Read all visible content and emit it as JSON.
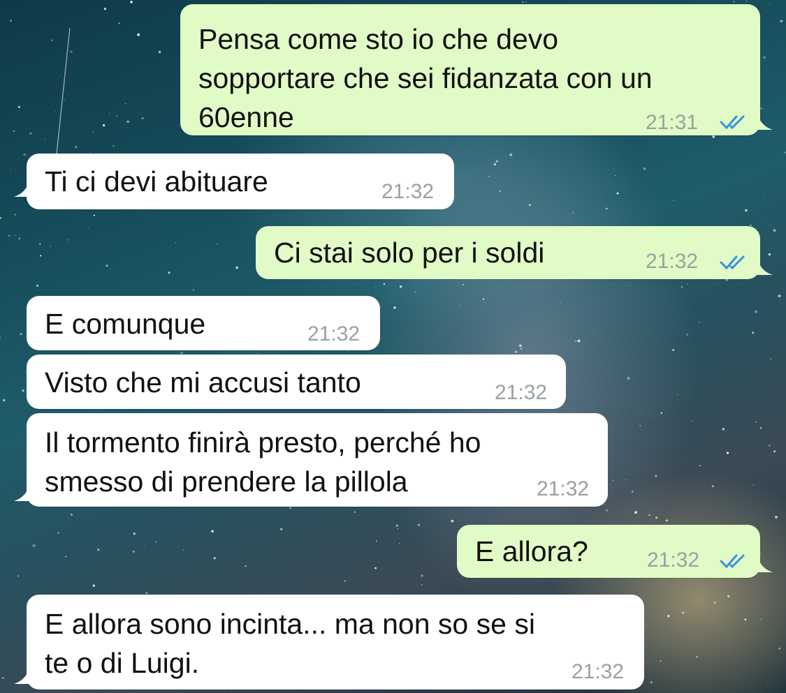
{
  "conversation": {
    "messages": [
      {
        "direction": "outgoing",
        "lines": [
          "Pensa come sto io che devo",
          "sopportare che sei fidanzata con un",
          "60enne"
        ],
        "time": "21:31",
        "read": true
      },
      {
        "direction": "incoming",
        "lines": [
          "Ti ci devi abituare"
        ],
        "time": "21:32"
      },
      {
        "direction": "outgoing",
        "lines": [
          "Ci stai solo per i soldi"
        ],
        "time": "21:32",
        "read": true
      },
      {
        "direction": "incoming",
        "lines": [
          "E comunque"
        ],
        "time": "21:32"
      },
      {
        "direction": "incoming",
        "lines": [
          "Visto che mi accusi tanto"
        ],
        "time": "21:32"
      },
      {
        "direction": "incoming",
        "lines": [
          "Il tormento finirà presto, perché ho",
          "smesso di prendere la pillola"
        ],
        "time": "21:32"
      },
      {
        "direction": "outgoing",
        "lines": [
          "E allora?"
        ],
        "time": "21:32",
        "read": true
      },
      {
        "direction": "incoming",
        "lines": [
          "E allora sono incinta... ma non so se si",
          "te o di Luigi."
        ],
        "time": "21:32"
      }
    ]
  },
  "colors": {
    "outgoing_bubble": "#e1fbc6",
    "incoming_bubble": "#ffffff",
    "read_ticks": "#3a8fe0",
    "timestamp": "#9aa0a2"
  },
  "icons": {
    "read_receipt": "double-check-icon"
  }
}
